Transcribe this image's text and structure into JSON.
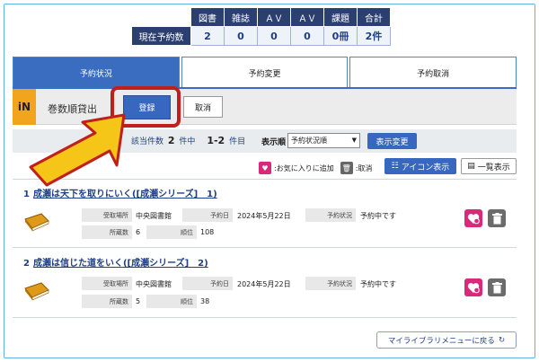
{
  "summary": {
    "headers": [
      "図書",
      "雑誌",
      "ＡＶ",
      "ＡＶ",
      "課題",
      "合計"
    ],
    "row_label": "現在予約数",
    "values": [
      "2",
      "0",
      "0",
      "0",
      "0冊",
      "2件"
    ]
  },
  "tabs": [
    {
      "label": "予約状況",
      "active": true
    },
    {
      "label": "予約変更",
      "active": false
    },
    {
      "label": "予約取消",
      "active": false
    }
  ],
  "action": {
    "icon_text": "iN",
    "title": "巻数順貸出",
    "register_label": "登録",
    "cancel_label": "取消"
  },
  "count": {
    "prefix": "該当件数",
    "total": "2",
    "unit": "件中",
    "range": "1-2",
    "range_unit": "件目",
    "sort_label": "表示順",
    "sort_value": "予約状況順",
    "sort_button": "表示変更"
  },
  "legend": {
    "favorite_text": ":お気に入りに追加",
    "delete_text": ":取消",
    "icon_view": "アイコン表示",
    "list_view": "一覧表示"
  },
  "labels": {
    "pickup": "受取場所",
    "reserve_date": "予約日",
    "status": "予約状況",
    "holdings": "所蔵数",
    "rank": "順位"
  },
  "items": [
    {
      "index": "1",
      "title": "成瀬は天下を取りにいく([成瀬シリーズ]　1)",
      "pickup": "中央図書館",
      "reserve_date": "2024年5月22日",
      "status": "予約中です",
      "holdings": "6",
      "rank": "108"
    },
    {
      "index": "2",
      "title": "成瀬は信じた道をいく([成瀬シリーズ]　2)",
      "pickup": "中央図書館",
      "reserve_date": "2024年5月22日",
      "status": "予約中です",
      "holdings": "5",
      "rank": "38"
    }
  ],
  "footer": {
    "back_label": "マイライブラリメニューに戻る"
  },
  "colors": {
    "accent": "#3867bf",
    "header_navy": "#2b3f70",
    "highlight_red": "#c0201b",
    "arrow_yellow": "#f5c518",
    "favorite_pink": "#d9297b"
  }
}
